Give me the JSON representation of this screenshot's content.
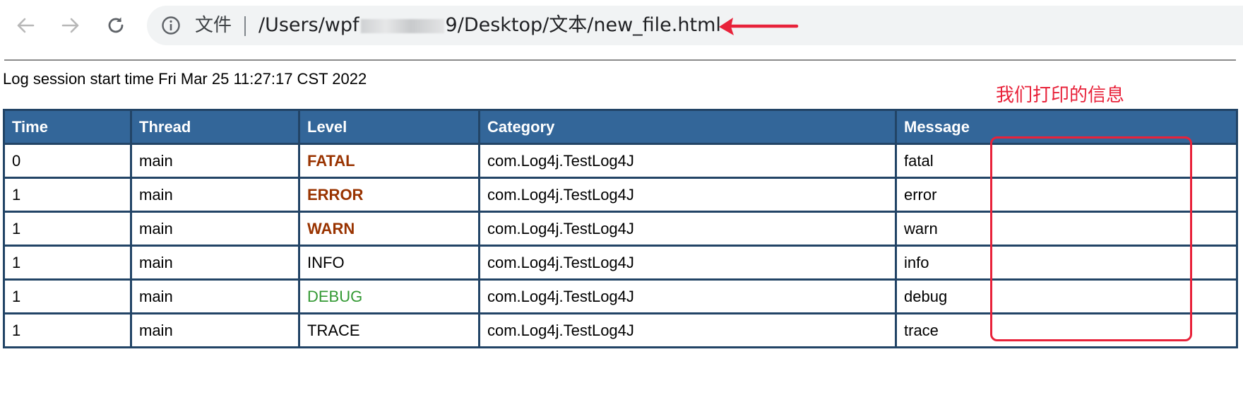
{
  "browser": {
    "file_label": "文件",
    "url_prefix": "/Users/wpf",
    "url_mid": "9",
    "url_suffix": "/Desktop/文本/new_file.html"
  },
  "session_line": "Log session start time Fri Mar 25 11:27:17 CST 2022",
  "annotation_note": "我们打印的信息",
  "table": {
    "headers": [
      "Time",
      "Thread",
      "Level",
      "Category",
      "Message"
    ],
    "rows": [
      {
        "time": "0",
        "thread": "main",
        "level": "FATAL",
        "category": "com.Log4j.TestLog4J",
        "message": "fatal"
      },
      {
        "time": "1",
        "thread": "main",
        "level": "ERROR",
        "category": "com.Log4j.TestLog4J",
        "message": "error"
      },
      {
        "time": "1",
        "thread": "main",
        "level": "WARN",
        "category": "com.Log4j.TestLog4J",
        "message": "warn"
      },
      {
        "time": "1",
        "thread": "main",
        "level": "INFO",
        "category": "com.Log4j.TestLog4J",
        "message": "info"
      },
      {
        "time": "1",
        "thread": "main",
        "level": "DEBUG",
        "category": "com.Log4j.TestLog4J",
        "message": "debug"
      },
      {
        "time": "1",
        "thread": "main",
        "level": "TRACE",
        "category": "com.Log4j.TestLog4J",
        "message": "trace"
      }
    ]
  },
  "colors": {
    "header_bg": "#336699",
    "border": "#224466",
    "level_alert": "#993300",
    "level_debug": "#339933",
    "annotation_red": "#e8223a"
  },
  "icons": {
    "back": "arrow-left-icon",
    "forward": "arrow-right-icon",
    "reload": "reload-icon",
    "info": "info-circle-icon"
  }
}
